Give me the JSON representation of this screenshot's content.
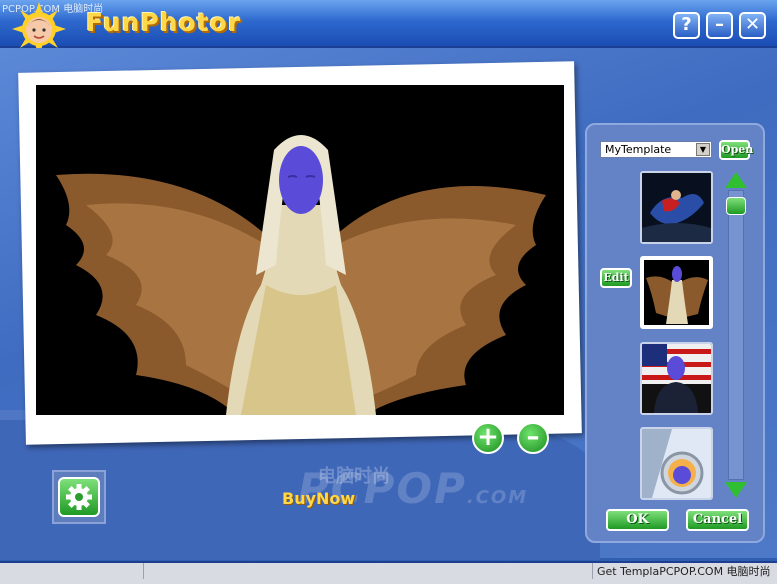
{
  "app": {
    "title": "FunPhotor",
    "watermark_top": "PCPOP.COM 电脑时尚"
  },
  "window_controls": {
    "help": "?",
    "minimize": "–",
    "close": "✕"
  },
  "template_panel": {
    "selected_template": "MyTemplate",
    "open_label": "Open",
    "edit_label": "Edit"
  },
  "footer": {
    "buy_now": "BuyNow",
    "ok_label": "OK",
    "cancel_label": "Cancel",
    "watermark_brand": "PCPOP",
    "watermark_domain": ".COM",
    "watermark_cn": "电脑时尚"
  },
  "statusbar": {
    "text": "Get TemplaPCPOP.COM 电脑时尚"
  },
  "colors": {
    "accent_green": "#2fbf30",
    "title_yellow": "#ffd84a",
    "frame_blue": "#3b66b8"
  }
}
